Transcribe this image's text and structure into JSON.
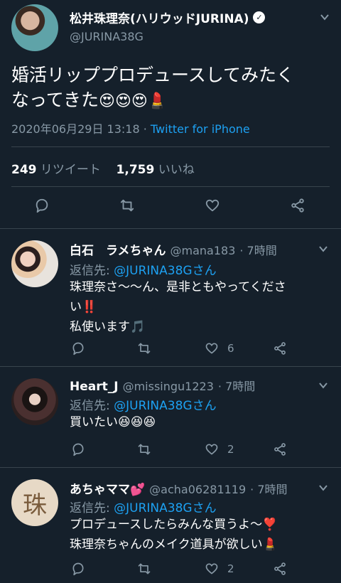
{
  "main_tweet": {
    "author_name": "松井珠理奈(ハリウッドJURINA)",
    "handle": "@JURINA38G",
    "text_line1": "婚活リッププロデュースしてみたく",
    "text_line2": "なってきた",
    "emojis": "😍😍😍💄",
    "date": "2020年06月29日 13:18",
    "separator": "·",
    "source": "Twitter for iPhone",
    "retweet_count": "249",
    "retweet_label": "リツイート",
    "like_count": "1,759",
    "like_label": "いいね"
  },
  "replies": [
    {
      "name": "白石　ラメちゃん",
      "handle": "@mana183",
      "time": "· 7時間",
      "reply_to_label": "返信先:",
      "reply_to_user": "@JURINA38Gさん",
      "line1": "珠理奈さ〜〜ん、是非ともやってくださ",
      "line2": "い‼️",
      "line3": "私使います🎵",
      "like_count": "6"
    },
    {
      "name": "Heart_J",
      "handle": "@missingu1223",
      "time": "· 7時間",
      "reply_to_label": "返信先:",
      "reply_to_user": "@JURINA38Gさん",
      "line1": "買いたい😆😆😆",
      "like_count": "2"
    },
    {
      "name": "あちゃママ💕",
      "handle": "@acha06281119",
      "time": "· 7時間",
      "reply_to_label": "返信先:",
      "reply_to_user": "@JURINA38Gさん",
      "line1": "プロデュースしたらみんな買うよ〜❣️",
      "line2": "珠理奈ちゃんのメイク道具が欲しい💄",
      "avatar_char": "珠",
      "like_count": "2"
    }
  ],
  "colors": {
    "background": "#15202b",
    "text_primary": "#ffffff",
    "text_secondary": "#8899a6",
    "link": "#1da1f2",
    "divider": "#38444d"
  },
  "icons": [
    "verified-badge-icon",
    "chevron-down-icon",
    "reply-icon",
    "retweet-icon",
    "like-icon",
    "share-icon"
  ]
}
